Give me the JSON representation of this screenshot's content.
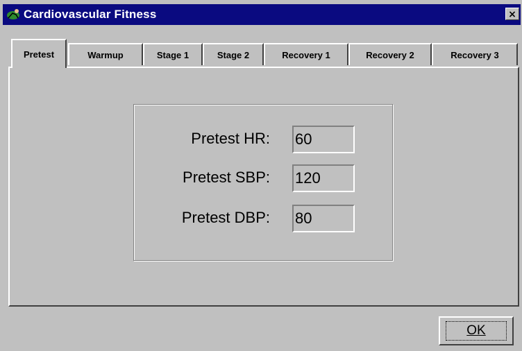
{
  "window": {
    "title": "Cardiovascular Fitness",
    "close_glyph": "×",
    "icon": "runner-icon"
  },
  "tabs": [
    {
      "label": "Pretest",
      "active": true
    },
    {
      "label": "Warmup",
      "active": false
    },
    {
      "label": "Stage 1",
      "active": false
    },
    {
      "label": "Stage 2",
      "active": false
    },
    {
      "label": "Recovery 1",
      "active": false
    },
    {
      "label": "Recovery 2",
      "active": false
    },
    {
      "label": "Recovery 3",
      "active": false
    }
  ],
  "pretest": {
    "fields": [
      {
        "label": "Pretest HR:",
        "value": "60"
      },
      {
        "label": "Pretest SBP:",
        "value": "120"
      },
      {
        "label": "Pretest DBP:",
        "value": "80"
      }
    ]
  },
  "footer": {
    "ok_label": "OK"
  },
  "colors": {
    "titlebar": "#0a0a80",
    "face": "#c0c0c0"
  }
}
